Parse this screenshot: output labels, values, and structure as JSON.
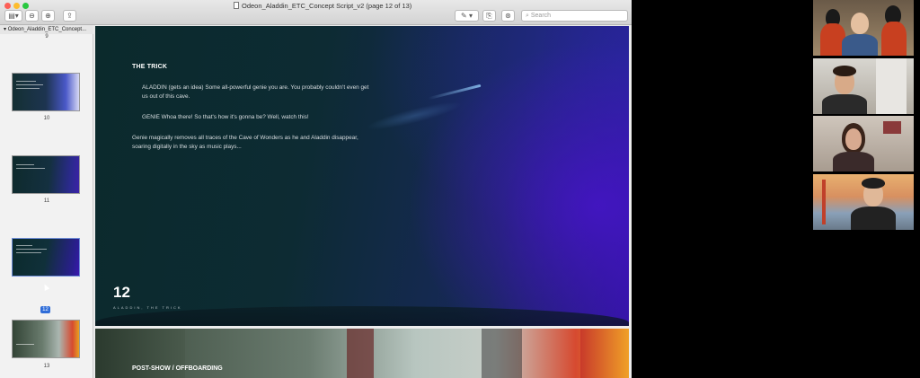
{
  "window": {
    "title": "Odeon_Aladdin_ETC_Concept Script_v2 (page 12 of 13)",
    "search_placeholder": "Search"
  },
  "sidebar": {
    "document_name": "Odeon_Aladdin_ETC_Concept...",
    "top_number": "9",
    "thumbnails": [
      {
        "page": "10"
      },
      {
        "page": "11"
      },
      {
        "page": "12",
        "selected": true
      },
      {
        "page": "13"
      }
    ]
  },
  "page": {
    "heading": "THE TRICK",
    "line1": "ALADDIN (gets an idea) Some all-powerful genie you are. You probably couldn't even get us out of this cave.",
    "line2": "GENIE Whoa there! So that's how it's gonna be? Well, watch this!",
    "line3": "Genie magically removes all traces of the Cave of Wonders as he and Aladdin disappear, soaring digitally in the sky as music plays...",
    "page_number": "12",
    "footer": "ALADDIN, THE TRICK"
  },
  "next_page": {
    "heading": "POST-SHOW / OFFBOARDING"
  },
  "colors": {
    "selection": "#2f6dd8",
    "slide_bg": "#0d2b33",
    "slide_accent": "#3114a0"
  }
}
